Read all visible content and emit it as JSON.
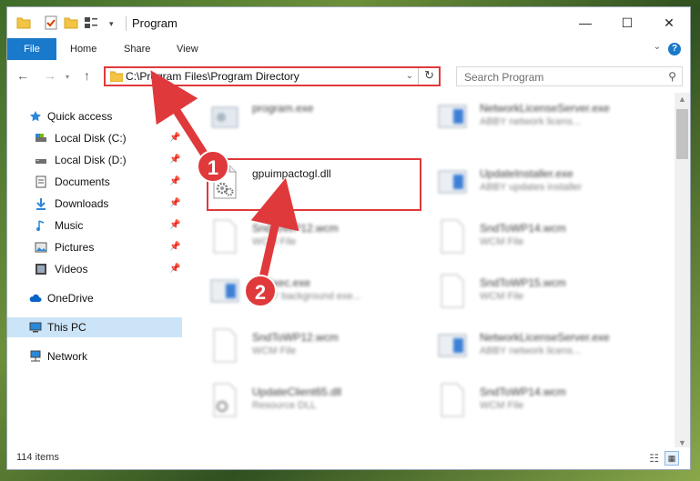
{
  "window": {
    "title": "Program",
    "controls": {
      "minimize": "—",
      "maximize": "☐",
      "close": "✕"
    }
  },
  "ribbon": {
    "tabs": [
      "File",
      "Home",
      "Share",
      "View"
    ],
    "help": "?"
  },
  "navigation": {
    "address": "C:\\Program Files\\Program Directory",
    "search_placeholder": "Search Program"
  },
  "sidebar": {
    "items": [
      {
        "label": "Quick access",
        "icon": "star-icon"
      },
      {
        "label": "Local Disk (C:)",
        "icon": "drive-icon",
        "pinned": true
      },
      {
        "label": "Local Disk (D:)",
        "icon": "drive-icon",
        "pinned": true
      },
      {
        "label": "Documents",
        "icon": "documents-icon",
        "pinned": true
      },
      {
        "label": "Downloads",
        "icon": "downloads-icon",
        "pinned": true
      },
      {
        "label": "Music",
        "icon": "music-icon",
        "pinned": true
      },
      {
        "label": "Pictures",
        "icon": "pictures-icon",
        "pinned": true
      },
      {
        "label": "Videos",
        "icon": "videos-icon",
        "pinned": true
      },
      {
        "label": "OneDrive",
        "icon": "cloud-icon"
      },
      {
        "label": "This PC",
        "icon": "computer-icon",
        "selected": true
      },
      {
        "label": "Network",
        "icon": "network-icon"
      }
    ]
  },
  "files": [
    {
      "name": "program.exe",
      "desc": "",
      "type": "exe"
    },
    {
      "name": "NetworkLicenseServer.exe",
      "desc": "ABBY network licens...",
      "type": "app"
    },
    {
      "name": "gpuimpactogl.dll",
      "desc": "",
      "type": "dll",
      "highlighted": true
    },
    {
      "name": "UpdateInstaller.exe",
      "desc": "ABBY updates installer",
      "type": "app"
    },
    {
      "name": "SndToWP12.wcm",
      "desc": "WCM File",
      "type": "doc"
    },
    {
      "name": "SndToWP14.wcm",
      "desc": "WCM File",
      "type": "doc"
    },
    {
      "name": "BgExec.exe",
      "desc": "ABBY background exe...",
      "type": "app"
    },
    {
      "name": "SndToWP15.wcm",
      "desc": "WCM File",
      "type": "doc"
    },
    {
      "name": "SndToWP12.wcm",
      "desc": "WCM File",
      "type": "doc"
    },
    {
      "name": "NetworkLicenseServer.exe",
      "desc": "ABBY network licens...",
      "type": "app"
    },
    {
      "name": "UpdateClient65.dll",
      "desc": "Resource DLL",
      "type": "dll"
    },
    {
      "name": "SndToWP14.wcm",
      "desc": "WCM File",
      "type": "doc"
    }
  ],
  "status": {
    "item_count": "114 items"
  },
  "annotations": {
    "step1": "1",
    "step2": "2",
    "color": "#e0393b"
  }
}
